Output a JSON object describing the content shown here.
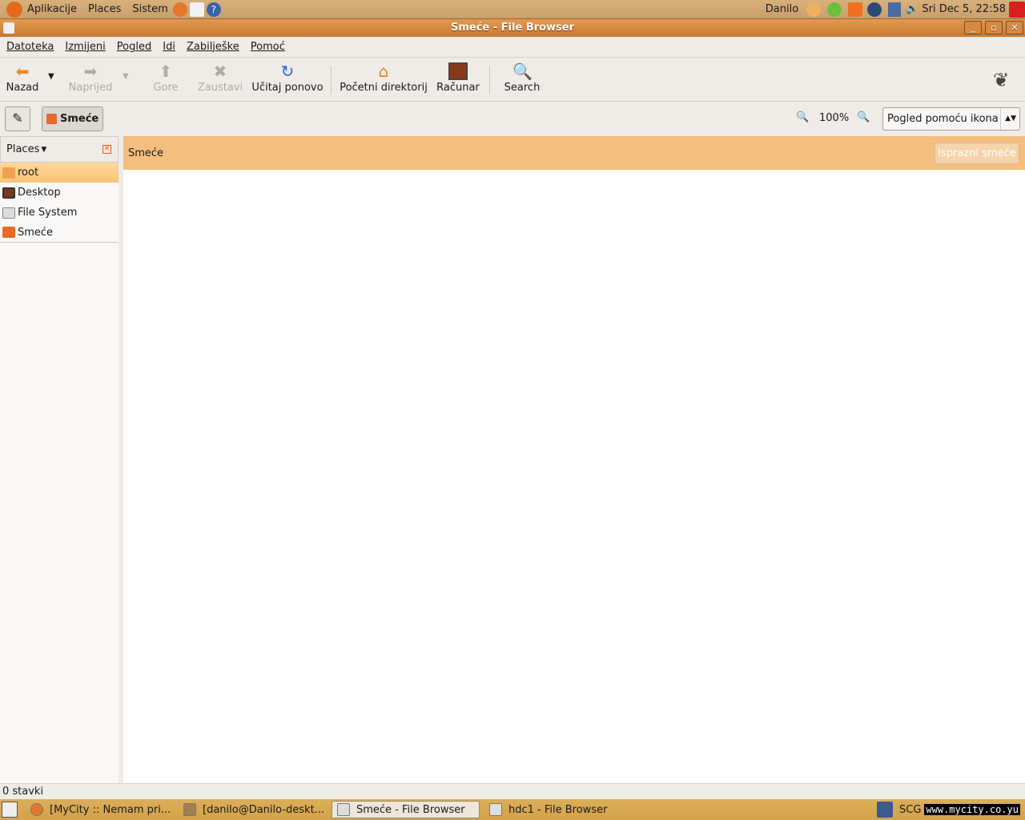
{
  "top_panel": {
    "menus": [
      "Aplikacije",
      "Places",
      "Sistem"
    ],
    "user": "Danilo",
    "clock": "Sri Dec  5, 22:58"
  },
  "window": {
    "title": "Smeće - File Browser"
  },
  "menubar": [
    "Datoteka",
    "Izmijeni",
    "Pogled",
    "Idi",
    "Zabilješke",
    "Pomoć"
  ],
  "toolbar": {
    "back": "Nazad",
    "forward": "Naprijed",
    "up": "Gore",
    "stop": "Zaustavi",
    "reload": "Učitaj ponovo",
    "home": "Početni direktorij",
    "computer": "Računar",
    "search": "Search"
  },
  "location": {
    "current": "Smeće",
    "zoom": "100%",
    "view_mode": "Pogled pomoću ikona"
  },
  "sidebar": {
    "title": "Places",
    "items": [
      {
        "label": "root"
      },
      {
        "label": "Desktop"
      },
      {
        "label": "File System"
      },
      {
        "label": "Smeće"
      }
    ]
  },
  "content": {
    "info_title": "Smeće",
    "empty_trash": "Isprazni smeće"
  },
  "status": "0 stavki",
  "taskbar": {
    "tasks": [
      "[MyCity :: Nemam pri...",
      "[danilo@Danilo-deskt...",
      "Smeće - File Browser",
      "hdc1 - File Browser"
    ],
    "tray_text": "SCG",
    "watermark": "www.mycity.co.yu"
  },
  "colors": {
    "accent": "#f4be7e",
    "titlebar": "#d98a3e",
    "panel": "#d4a24a"
  }
}
